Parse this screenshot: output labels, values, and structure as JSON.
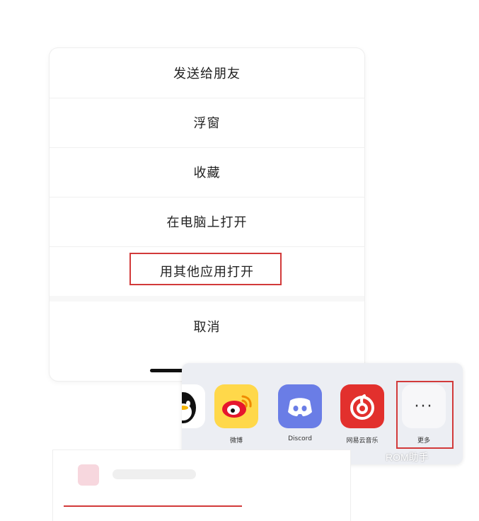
{
  "menu": {
    "items": [
      {
        "label": "发送给朋友"
      },
      {
        "label": "浮窗"
      },
      {
        "label": "收藏"
      },
      {
        "label": "在电脑上打开"
      },
      {
        "label": "用其他应用打开"
      },
      {
        "label": "取消"
      }
    ]
  },
  "share": {
    "apps": [
      {
        "name": "qq",
        "label": ""
      },
      {
        "name": "weibo",
        "label": "微博"
      },
      {
        "name": "discord",
        "label": "Discord"
      },
      {
        "name": "netease-music",
        "label": "网易云音乐"
      },
      {
        "name": "more",
        "label": "更多"
      }
    ],
    "more_icon_glyph": "···"
  },
  "watermark": {
    "text": "ROM助手"
  },
  "colors": {
    "highlight": "#d23a3a",
    "weibo": "#ffd84a",
    "discord": "#6a7de6",
    "netease": "#e2302d"
  }
}
